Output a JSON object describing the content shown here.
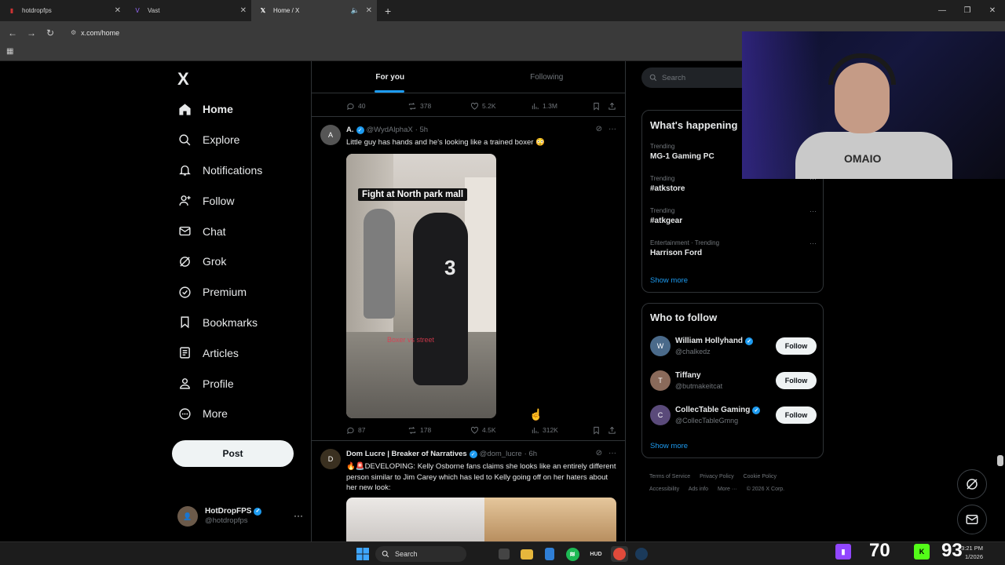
{
  "browser": {
    "tabs": [
      {
        "title": "hotdropfps",
        "active": false
      },
      {
        "title": "Vast",
        "active": false
      },
      {
        "title": "Home / X",
        "active": true
      }
    ],
    "url": "x.com/home"
  },
  "sidebar": {
    "logo": "X",
    "items": [
      {
        "label": "Home",
        "icon": "home-icon"
      },
      {
        "label": "Explore",
        "icon": "search-icon"
      },
      {
        "label": "Notifications",
        "icon": "bell-icon"
      },
      {
        "label": "Follow",
        "icon": "person-add-icon"
      },
      {
        "label": "Chat",
        "icon": "mail-icon"
      },
      {
        "label": "Grok",
        "icon": "grok-icon"
      },
      {
        "label": "Premium",
        "icon": "premium-icon"
      },
      {
        "label": "Bookmarks",
        "icon": "bookmark-icon"
      },
      {
        "label": "Articles",
        "icon": "article-icon"
      },
      {
        "label": "Profile",
        "icon": "person-icon"
      },
      {
        "label": "More",
        "icon": "more-circle-icon"
      }
    ],
    "post_label": "Post",
    "account": {
      "display_name": "HotDropFPS",
      "handle": "@hotdropfps"
    }
  },
  "feed": {
    "tabs": [
      "For you",
      "Following"
    ],
    "prev_post_stats": {
      "replies": "40",
      "reposts": "378",
      "likes": "5.2K",
      "views": "1.3M"
    },
    "posts": [
      {
        "name": "A.",
        "handle": "@WydAlphaX",
        "time": "· 5h",
        "text": "Little guy has hands and he's looking like a trained boxer 😳",
        "media_caption": "Fight at North park mall",
        "media_overlay": "Boxer vs street",
        "jersey_number": "3",
        "stats": {
          "replies": "87",
          "reposts": "178",
          "likes": "4.5K",
          "views": "312K"
        }
      },
      {
        "name": "Dom Lucre | Breaker of Narratives",
        "handle": "@dom_lucre",
        "time": "· 6h",
        "text": "🔥🚨DEVELOPING: Kelly Osborne fans claims she looks like an entirely different person similar to Jim Carey which has led to Kelly going off on her haters about her new look:"
      }
    ]
  },
  "right": {
    "search_placeholder": "Search",
    "happening_title": "What's happening",
    "trends": [
      {
        "meta": "Trending",
        "topic": "MG-1 Gaming PC"
      },
      {
        "meta": "Trending",
        "topic": "#atkstore"
      },
      {
        "meta": "Trending",
        "topic": "#atkgear"
      },
      {
        "meta": "Entertainment · Trending",
        "topic": "Harrison Ford"
      }
    ],
    "show_more": "Show more",
    "who_title": "Who to follow",
    "who": [
      {
        "name": "William Hollyhand",
        "handle": "@chalkedz",
        "btn": "Follow",
        "color": "#4a6a8a"
      },
      {
        "name": "Tiffany",
        "handle": "@butmakeitcat",
        "btn": "Follow",
        "color": "#8a6a5a"
      },
      {
        "name": "CollecTable Gaming",
        "handle": "@CollecTableGmng",
        "btn": "Follow",
        "color": "#5a4a7a"
      }
    ],
    "footer_links": [
      "Terms of Service",
      "Privacy Policy",
      "Cookie Policy",
      "Accessibility",
      "Ads info",
      "More ···",
      "© 2026 X Corp."
    ]
  },
  "webcam": {
    "shirt_text": "OMAIO"
  },
  "taskbar": {
    "search_label": "Search",
    "stat_left": "70",
    "stat_right": "93",
    "time": "3:21 PM",
    "date": "1/2026"
  }
}
